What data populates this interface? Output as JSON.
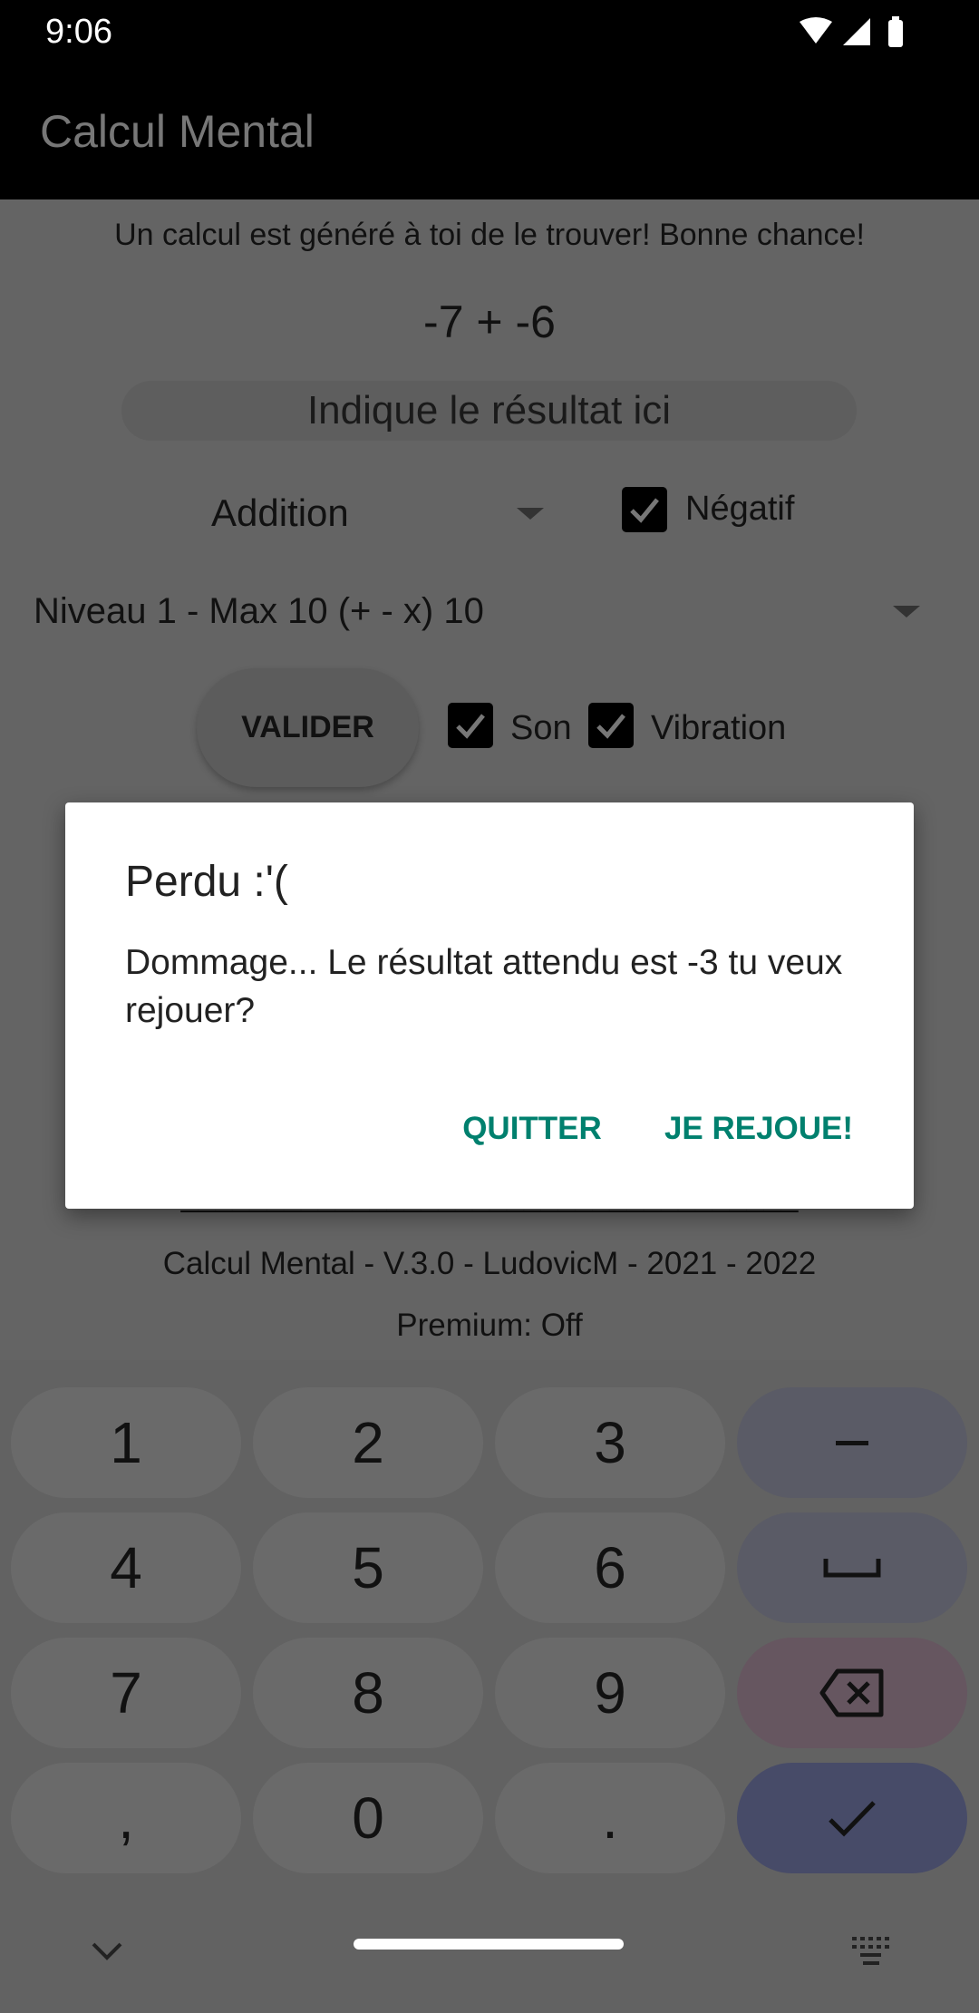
{
  "status_bar": {
    "time": "9:06",
    "icons": [
      "wifi-icon",
      "signal-icon",
      "battery-icon"
    ]
  },
  "app_bar": {
    "title": "Calcul Mental"
  },
  "main": {
    "instruction": "Un calcul est généré à toi de le trouver! Bonne chance!",
    "equation": "-7 + -6",
    "answer_input": {
      "value": "",
      "placeholder": "Indique le résultat ici"
    },
    "operation_select": {
      "value": "Addition"
    },
    "negatif_checkbox": {
      "label": "Négatif",
      "checked": true
    },
    "level_select": {
      "value": "Niveau 1 - Max 10 (+ - x) 10"
    },
    "validate_button": "VALIDER",
    "son_checkbox": {
      "label": "Son",
      "checked": true
    },
    "vibration_checkbox": {
      "label": "Vibration",
      "checked": true
    },
    "separator": "____________________________________",
    "version": "Calcul Mental - V.3.0 - LudovicM - 2021 - 2022",
    "premium": "Premium: Off"
  },
  "dialog": {
    "title": "Perdu :'(",
    "message": "Dommage... Le résultat attendu est -3 tu veux rejouer?",
    "quit_button": "QUITTER",
    "replay_button": "JE REJOUE!",
    "accent_color": "#00806e"
  },
  "keyboard": {
    "keys": [
      "1",
      "2",
      "3",
      "–",
      "4",
      "5",
      "6",
      "␣",
      "7",
      "8",
      "9",
      "⌫",
      ",",
      "0",
      ".",
      "✓"
    ],
    "key_icons": {
      "minus": "minus-icon",
      "space": "space-icon",
      "backspace": "backspace-icon",
      "enter": "check-icon"
    },
    "bottom_icons": [
      "chevron-down-icon",
      "keyboard-icon"
    ]
  }
}
